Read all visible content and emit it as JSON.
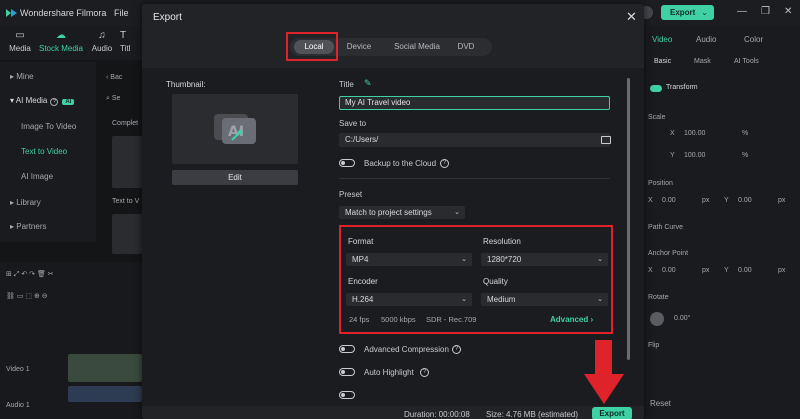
{
  "app": {
    "title": "Wondershare Filmora",
    "menu_file": "File",
    "export_label": "Export",
    "colors": {
      "accent": "#3fd0a4",
      "highlight": "#e0232b"
    }
  },
  "toolbar_tabs": [
    {
      "label": "Media",
      "icon": "folder-icon"
    },
    {
      "label": "Stock Media",
      "icon": "cloud-icon"
    },
    {
      "label": "Audio",
      "icon": "music-icon"
    },
    {
      "label": "Titl",
      "icon": "text-icon"
    }
  ],
  "left_nav": {
    "mine": "Mine",
    "ai_media": "AI Media",
    "ai_badge": "AI",
    "image_to_video": "Image To Video",
    "text_to_video": "Text to Video",
    "ai_image": "AI Image",
    "library": "Library",
    "partners": "Partners"
  },
  "media_col": {
    "back": "Bac",
    "search": "Se",
    "complete": "Complet",
    "text_to_v": "Text to V"
  },
  "timeline": {
    "video_track": "Video 1",
    "audio_track": "Audio 1"
  },
  "right_panel": {
    "tabs": [
      "Video",
      "Audio",
      "Color"
    ],
    "subtabs": [
      "Basic",
      "Mask",
      "AI Tools"
    ],
    "transform": "Transform",
    "scale": "Scale",
    "x_label": "X",
    "y_label": "Y",
    "scale_x": "100.00",
    "scale_y": "100.00",
    "percent": "%",
    "position": "Position",
    "pos_x": "0.00",
    "pos_y": "0.00",
    "px": "px",
    "path_curve": "Path Curve",
    "anchor_point": "Anchor Point",
    "anchor_x": "0.00",
    "anchor_y": "0.00",
    "rotate": "Rotate",
    "rotate_value": "0.00°",
    "flip": "Flip",
    "reset": "Reset"
  },
  "modal": {
    "title": "Export",
    "tabs": [
      {
        "label": "Local",
        "active": true
      },
      {
        "label": "Device",
        "active": false
      },
      {
        "label": "Social Media",
        "active": false
      },
      {
        "label": "DVD",
        "active": false
      }
    ],
    "thumbnail_label": "Thumbnail:",
    "edit_label": "Edit",
    "title_label": "Title",
    "title_value": "My AI Travel video",
    "save_to_label": "Save to",
    "save_to_value": "C:/Users/",
    "backup_label": "Backup to the Cloud",
    "preset_label": "Preset",
    "preset_value": "Match to project settings",
    "format_label": "Format",
    "format_value": "MP4",
    "resolution_label": "Resolution",
    "resolution_value": "1280*720",
    "encoder_label": "Encoder",
    "encoder_value": "H.264",
    "quality_label": "Quality",
    "quality_value": "Medium",
    "fps": "24 fps",
    "bitrate": "5000 kbps",
    "color_space": "SDR - Rec.709",
    "advanced_label": "Advanced",
    "advanced_compression_label": "Advanced Compression",
    "auto_highlight_label": "Auto Highlight",
    "duration_text": "Duration: 00:00:08",
    "size_text": "Size: 4.76 MB (estimated)",
    "export_button": "Export"
  }
}
